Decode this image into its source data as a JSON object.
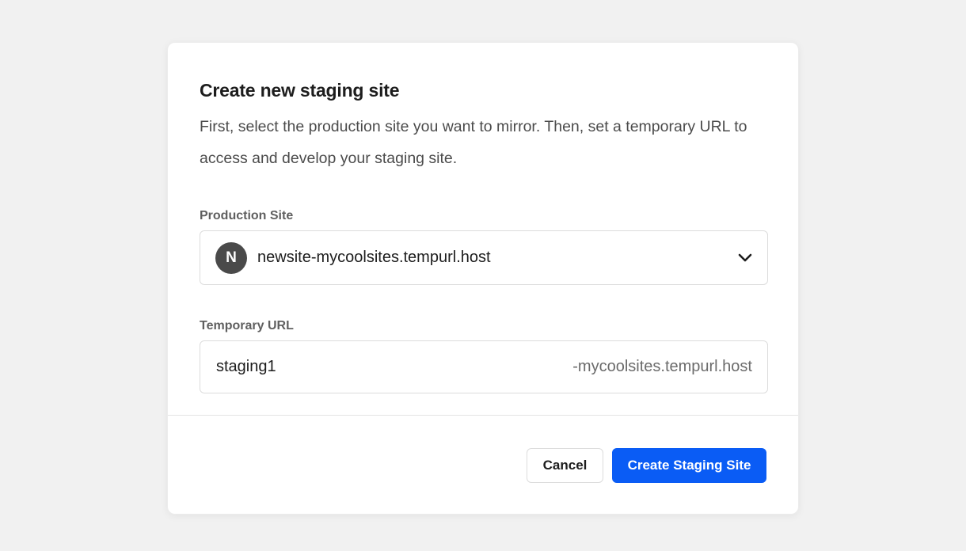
{
  "modal": {
    "title": "Create new staging site",
    "description": "First, select the production site you want to mirror. Then, set a temporary URL to access and develop your staging site."
  },
  "production_site": {
    "label": "Production Site",
    "avatar_letter": "N",
    "selected_value": "newsite-mycoolsites.tempurl.host",
    "icon": "chevron-down-icon"
  },
  "temporary_url": {
    "label": "Temporary URL",
    "value": "staging1",
    "suffix": "-mycoolsites.tempurl.host"
  },
  "footer": {
    "cancel_label": "Cancel",
    "create_label": "Create Staging Site"
  },
  "colors": {
    "primary": "#0a5cf5",
    "avatar": "#4a4a4a",
    "background": "#f1f1f1"
  }
}
